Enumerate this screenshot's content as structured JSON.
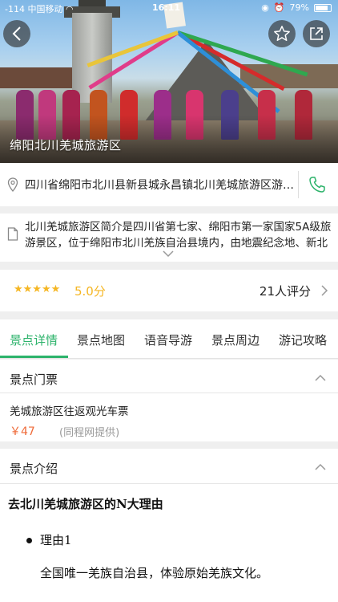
{
  "status_bar": {
    "signal": "-114",
    "carrier": "中国移动",
    "time": "16:11",
    "battery": "79%"
  },
  "hero": {
    "title": "绵阳北川羌城旅游区"
  },
  "address": {
    "text": "四川省绵阳市北川县新县城永昌镇北川羌城旅游区游客中心"
  },
  "intro": {
    "text": "北川羌城旅游区简介是四川省第七家、绵阳市第一家国家5A级旅游景区，位于绵阳市北川羌族自治县境内，由地震纪念地、新北川县城等构成。"
  },
  "rating": {
    "stars": "★★★★★",
    "score": "5.0分",
    "count": "21人评分"
  },
  "tabs": [
    {
      "label": "景点详情"
    },
    {
      "label": "景点地图"
    },
    {
      "label": "语音导游"
    },
    {
      "label": "景点周边"
    },
    {
      "label": "游记攻略"
    }
  ],
  "tickets": {
    "heading": "景点门票",
    "item_name": "羌城旅游区往返观光车票",
    "price": "￥47",
    "source": "(同程网提供)"
  },
  "intro_section": {
    "heading": "景点介绍",
    "article_title": "去北川羌城旅游区的N大理由",
    "reason_label": "理由1",
    "reason_text": "全国唯一羌族自治县，体验原始羌族文化。"
  },
  "colors": {
    "accent_green": "#2db36b",
    "star_gold": "#f5b623",
    "price_orange": "#ef6b3a"
  }
}
